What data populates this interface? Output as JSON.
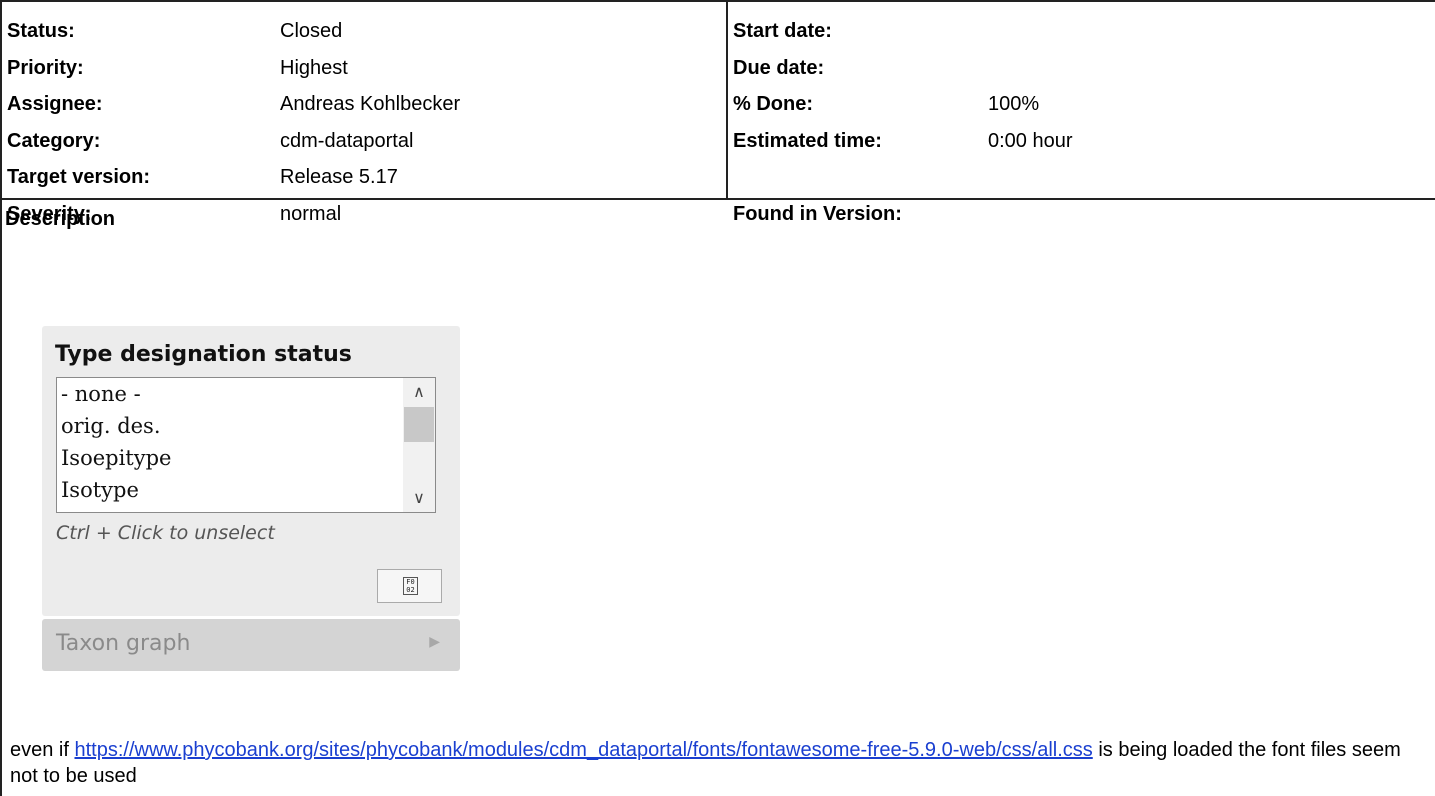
{
  "attributes": {
    "left": [
      {
        "label": "Status:",
        "value": "Closed"
      },
      {
        "label": "Priority:",
        "value": "Highest"
      },
      {
        "label": "Assignee:",
        "value": "Andreas Kohlbecker"
      },
      {
        "label": "Category:",
        "value": "cdm-dataportal"
      },
      {
        "label": "Target version:",
        "value": "Release 5.17"
      },
      {
        "label": "Severity:",
        "value": "normal"
      }
    ],
    "right": [
      {
        "label": "Start date:",
        "value": ""
      },
      {
        "label": "Due date:",
        "value": ""
      },
      {
        "label": "% Done:",
        "value": "100%"
      },
      {
        "label": "Estimated time:",
        "value": "0:00 hour"
      },
      {
        "label": "",
        "value": ""
      },
      {
        "label": "Found in Version:",
        "value": ""
      }
    ]
  },
  "description": {
    "title": "Description",
    "embedded_screenshot": {
      "title": "Type designation status",
      "options": [
        "- none -",
        "orig. des.",
        "Isoepitype",
        "Isotype"
      ],
      "hint": "Ctrl + Click to unselect",
      "glyph_label": "F0 02",
      "icons": {
        "scroll_up": "chevron-up-icon",
        "scroll_down": "chevron-down-icon",
        "collapsed": "caret-right-icon"
      },
      "taxon_graph_label": "Taxon graph"
    },
    "text_before": "even if ",
    "link": "https://www.phycobank.org/sites/phycobank/modules/cdm_dataportal/fonts/fontawesome-free-5.9.0-web/css/all.css",
    "text_after": " is being loaded the font files seem not to be used"
  }
}
